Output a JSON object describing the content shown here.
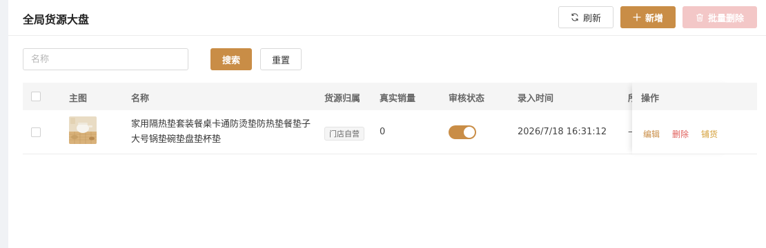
{
  "header": {
    "title": "全局货源大盘",
    "refresh_label": "刷新",
    "add_label": "新增",
    "batch_delete_label": "批量删除"
  },
  "search": {
    "placeholder": "名称",
    "value": "",
    "search_label": "搜索",
    "reset_label": "重置"
  },
  "table": {
    "columns": [
      "主图",
      "名称",
      "货源归属",
      "真实销量",
      "审核状态",
      "录入时间",
      "所",
      "操作"
    ],
    "rows": [
      {
        "name": "家用隔热垫套装餐桌卡通防烫垫防热垫餐垫子大号锅垫碗垫盘垫杯垫",
        "source": "门店自营",
        "sales": "0",
        "approved": true,
        "created_at": "2026/7/18 16:31:12",
        "truncated": "—",
        "actions": {
          "edit": "编辑",
          "delete": "删除",
          "stock": "铺货"
        }
      }
    ]
  },
  "colors": {
    "primary": "#c98d46",
    "danger_light": "#f3c7c7",
    "edit_action": "#c98d46",
    "delete_action": "#e0605c",
    "stock_action": "#d4a03a"
  },
  "icons": {
    "refresh": "refresh-icon",
    "add": "plus-icon",
    "batch_delete": "trash-icon"
  }
}
